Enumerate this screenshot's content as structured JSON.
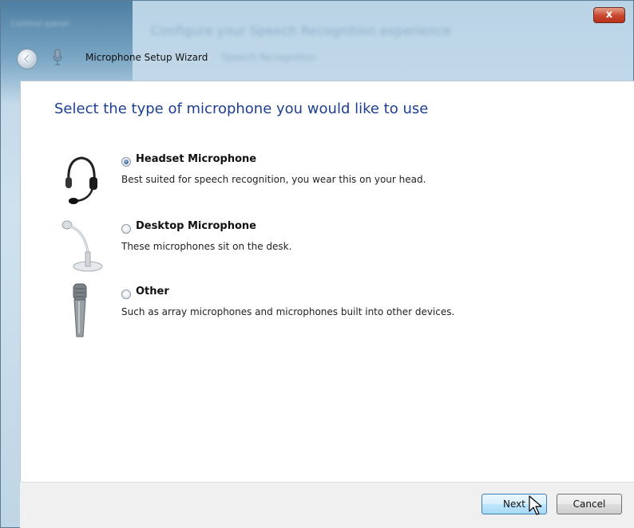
{
  "window": {
    "title": "Microphone Setup Wizard",
    "close_label": "x",
    "background_blurred_title": "Configure your Speech Recognition experience",
    "background_blurred_subtitle": "Speech Recognition",
    "background_blurred_corner": "Control panel"
  },
  "page": {
    "heading": "Select the type of microphone you would like to use"
  },
  "options": [
    {
      "title": "Headset Microphone",
      "description": "Best suited for speech recognition, you wear this on your head.",
      "icon": "headset-icon",
      "selected": true
    },
    {
      "title": "Desktop Microphone",
      "description": "These microphones sit on the desk.",
      "icon": "desktop-microphone-icon",
      "selected": false
    },
    {
      "title": "Other",
      "description": "Such as array microphones and microphones built into other devices.",
      "icon": "handheld-microphone-icon",
      "selected": false
    }
  ],
  "footer": {
    "next_label": "Next",
    "cancel_label": "Cancel"
  },
  "colors": {
    "heading": "#1e3f8f",
    "close_button": "#c8452e",
    "next_border": "#3c7fb1"
  }
}
